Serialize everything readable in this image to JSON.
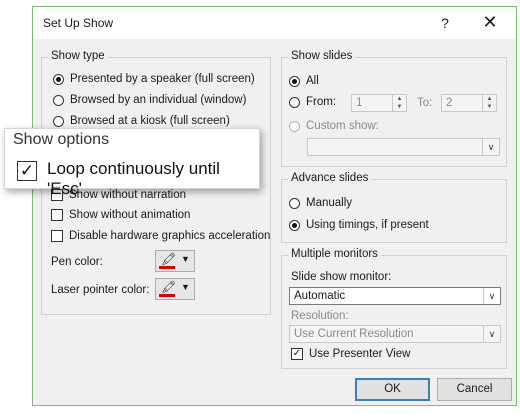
{
  "dialog": {
    "title": "Set Up Show",
    "help_glyph": "?",
    "close_glyph": "✕"
  },
  "show_type": {
    "title": "Show type",
    "options": [
      {
        "label": "Presented by a speaker (full screen)",
        "selected": true
      },
      {
        "label": "Browsed by an individual (window)",
        "selected": false
      },
      {
        "label": "Browsed at a kiosk (full screen)",
        "selected": false
      }
    ]
  },
  "show_options": {
    "title": "Show options",
    "loop_label": "Loop continuously until 'Esc'",
    "loop_checked": true,
    "items": [
      {
        "label": "Show without narration",
        "checked": false
      },
      {
        "label": "Show without animation",
        "checked": false
      },
      {
        "label": "Disable hardware graphics acceleration",
        "checked": false
      }
    ],
    "pen_color_label": "Pen color:",
    "laser_color_label": "Laser pointer color:",
    "pen_color": "#d40000",
    "laser_color": "#d40000"
  },
  "show_slides": {
    "title": "Show slides",
    "all_label": "All",
    "from_label": "From:",
    "from_value": "1",
    "to_label": "To:",
    "to_value": "2",
    "custom_label": "Custom show:",
    "custom_value": ""
  },
  "advance_slides": {
    "title": "Advance slides",
    "manual_label": "Manually",
    "timings_label": "Using timings, if present",
    "selected": "timings"
  },
  "monitors": {
    "title": "Multiple monitors",
    "monitor_label": "Slide show monitor:",
    "monitor_value": "Automatic",
    "resolution_label": "Resolution:",
    "resolution_value": "Use Current Resolution",
    "presenter_view_label": "Use Presenter View",
    "presenter_view_checked": true
  },
  "buttons": {
    "ok": "OK",
    "cancel": "Cancel"
  },
  "icons": {
    "check": "✓",
    "dropdown": "▼",
    "spin_up": "▲",
    "spin_down": "▼",
    "pen": "🖍"
  }
}
